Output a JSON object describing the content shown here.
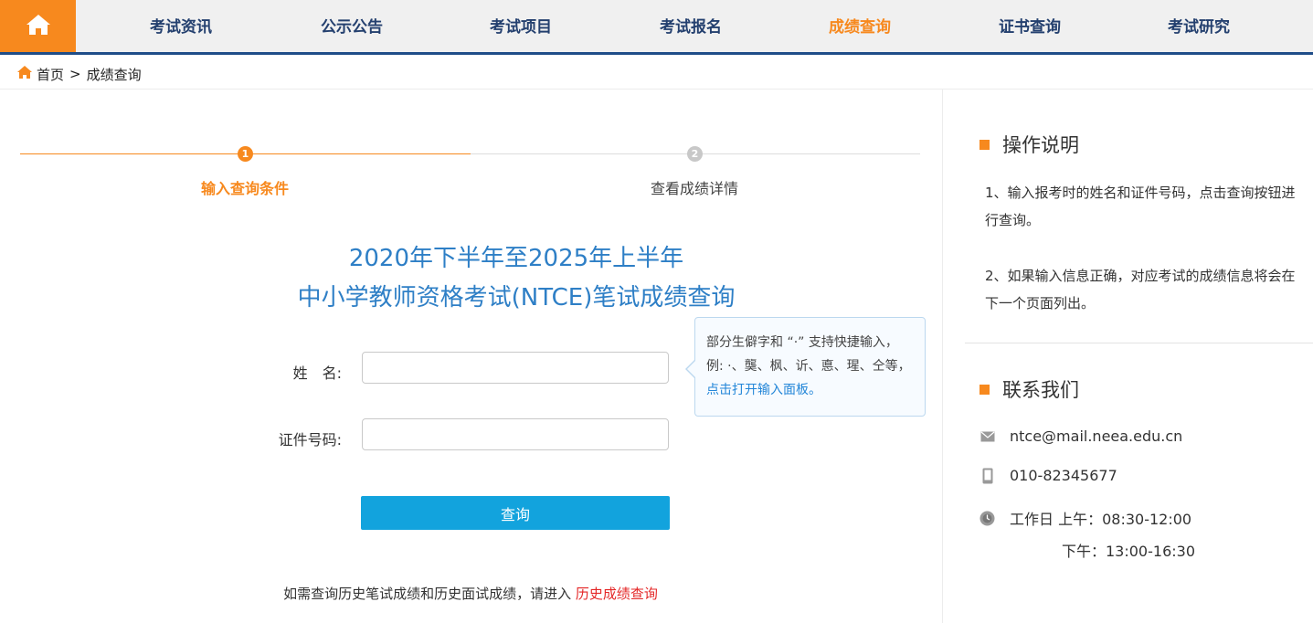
{
  "nav": {
    "items": [
      {
        "label": "考试资讯"
      },
      {
        "label": "公示公告"
      },
      {
        "label": "考试项目"
      },
      {
        "label": "考试报名"
      },
      {
        "label": "成绩查询"
      },
      {
        "label": "证书查询"
      },
      {
        "label": "考试研究"
      }
    ],
    "active_index": 4
  },
  "breadcrumb": {
    "home": "首页",
    "separator": ">",
    "current": "成绩查询"
  },
  "steps": [
    {
      "number": "1",
      "label": "输入查询条件"
    },
    {
      "number": "2",
      "label": "查看成绩详情"
    }
  ],
  "title": {
    "line1": "2020年下半年至2025年上半年",
    "line2": "中小学教师资格考试(NTCE)笔试成绩查询"
  },
  "form": {
    "name_label": "姓　名:",
    "name_value": "",
    "id_label": "证件号码:",
    "id_value": "",
    "submit_label": "查询"
  },
  "tooltip": {
    "text": "部分生僻字和 “·” 支持快捷输入，例: ·、龑、枫、䜣、悳、瑆、仝等，",
    "link": "点击打开输入面板。"
  },
  "history": {
    "text": "如需查询历史笔试成绩和历史面试成绩，请进入",
    "link": "历史成绩查询"
  },
  "sidebar": {
    "instructions_title": "操作说明",
    "instructions": [
      "1、输入报考时的姓名和证件号码，点击查询按钮进行查询。",
      "2、如果输入信息正确，对应考试的成绩信息将会在下一个页面列出。"
    ],
    "contact_title": "联系我们",
    "email": "ntce@mail.neea.edu.cn",
    "phone": "010-82345677",
    "hours_line1": "工作日 上午：08:30-12:00",
    "hours_line2": "下午：13:00-16:30"
  },
  "colors": {
    "accent": "#f7891e",
    "nav_text": "#24406f",
    "title": "#2e7fc6",
    "button": "#12a3dd",
    "link_red": "#e42727"
  }
}
